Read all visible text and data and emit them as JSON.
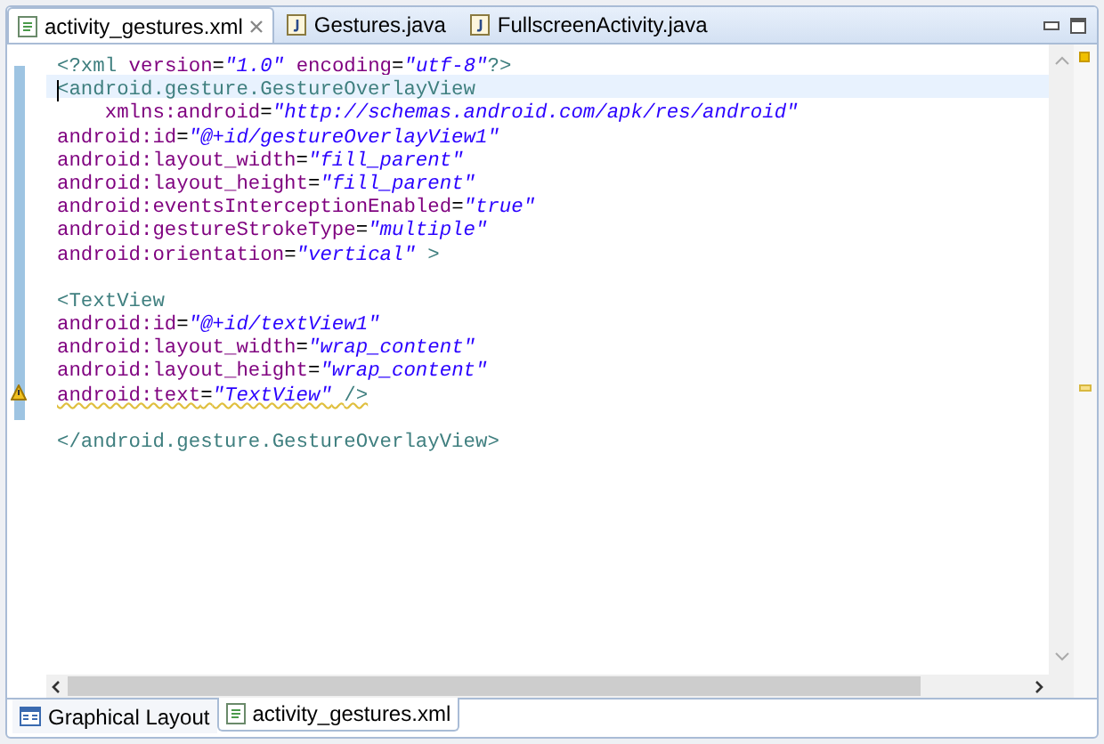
{
  "editor_tabs": [
    {
      "label": "activity_gestures.xml",
      "kind": "xml",
      "selected": true,
      "closable": true
    },
    {
      "label": "Gestures.java",
      "kind": "java",
      "selected": false,
      "closable": false
    },
    {
      "label": "FullscreenActivity.java",
      "kind": "java",
      "selected": false,
      "closable": false
    }
  ],
  "code_blocks": [
    {
      "lines": [
        {
          "text": "<?xml version=\"1.0\" encoding=\"utf-8\"?>",
          "current": false,
          "warning": false
        },
        {
          "text": "<android.gesture.GestureOverlayView",
          "current": true,
          "warning": false
        },
        {
          "text": "    xmlns:android=\"http://schemas.android.com/apk/res/android\"",
          "current": false,
          "warning": false
        },
        {
          "text": "android:id=\"@+id/gestureOverlayView1\"",
          "current": false,
          "warning": false
        },
        {
          "text": "android:layout_width=\"fill_parent\"",
          "current": false,
          "warning": false
        },
        {
          "text": "android:layout_height=\"fill_parent\"",
          "current": false,
          "warning": false
        },
        {
          "text": "android:eventsInterceptionEnabled=\"true\"",
          "current": false,
          "warning": false
        },
        {
          "text": "android:gestureStrokeType=\"multiple\"",
          "current": false,
          "warning": false
        },
        {
          "text": "android:orientation=\"vertical\" >",
          "current": false,
          "warning": false
        }
      ]
    },
    {
      "lines": [
        {
          "text": "<TextView",
          "current": false,
          "warning": false
        },
        {
          "text": "android:id=\"@+id/textView1\"",
          "current": false,
          "warning": false
        },
        {
          "text": "android:layout_width=\"wrap_content\"",
          "current": false,
          "warning": false
        },
        {
          "text": "android:layout_height=\"wrap_content\"",
          "current": false,
          "warning": false
        },
        {
          "text": "android:text=\"TextView\" />",
          "current": false,
          "warning": true
        }
      ]
    },
    {
      "lines": [
        {
          "text": "</android.gesture.GestureOverlayView>",
          "current": false,
          "warning": false
        }
      ]
    }
  ],
  "bottom_tabs": [
    {
      "label": "Graphical Layout",
      "kind": "layout",
      "selected": false
    },
    {
      "label": "activity_gestures.xml",
      "kind": "xml",
      "selected": true
    }
  ]
}
